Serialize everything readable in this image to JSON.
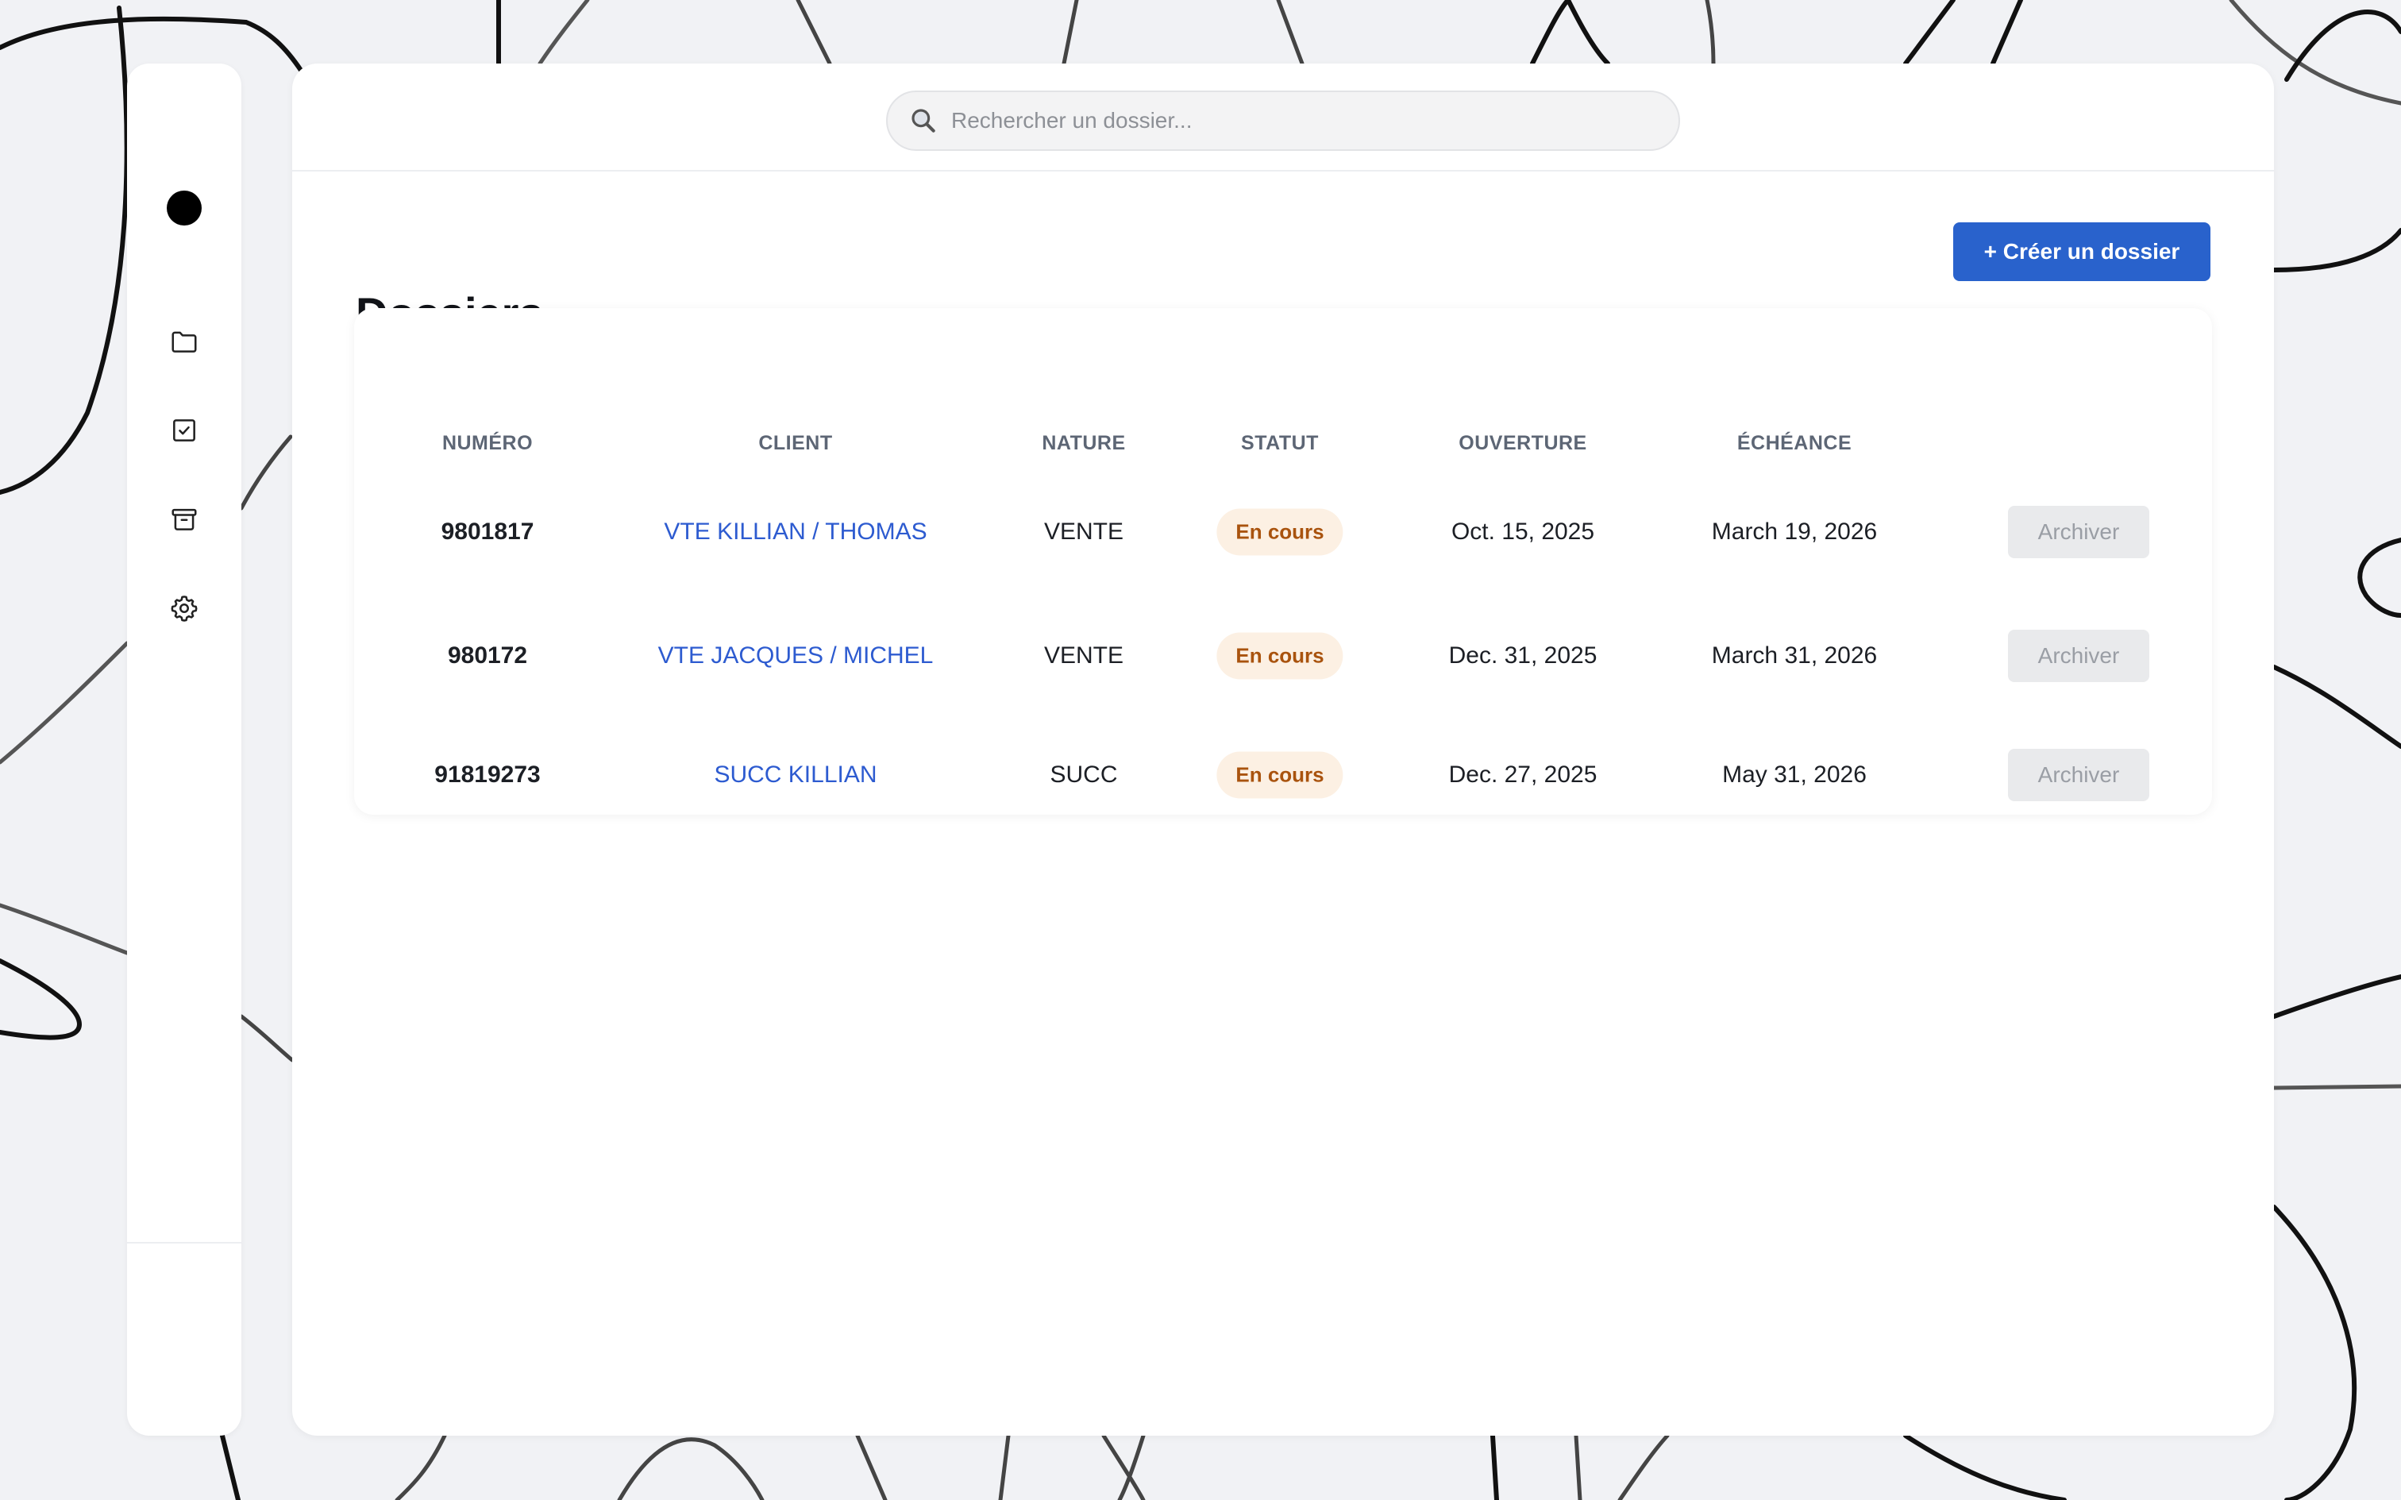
{
  "search": {
    "placeholder": "Rechercher un dossier..."
  },
  "header": {
    "title": "Dossiers",
    "create_label": "+ Créer un dossier"
  },
  "sidebar": {
    "items": [
      {
        "icon": "folder-icon"
      },
      {
        "icon": "checkbox-icon"
      },
      {
        "icon": "archive-icon"
      },
      {
        "icon": "gear-icon"
      }
    ]
  },
  "table": {
    "headers": {
      "numero": "NUMÉRO",
      "client": "CLIENT",
      "nature": "NATURE",
      "statut": "STATUT",
      "ouverture": "OUVERTURE",
      "echeance": "ÉCHÉANCE"
    },
    "rows": [
      {
        "numero": "9801817",
        "client": "VTE KILLIAN / THOMAS",
        "nature": "VENTE",
        "statut": "En cours",
        "ouverture": "Oct. 15, 2025",
        "echeance": "March 19, 2026",
        "action": "Archiver"
      },
      {
        "numero": "980172",
        "client": "VTE JACQUES / MICHEL",
        "nature": "VENTE",
        "statut": "En cours",
        "ouverture": "Dec. 31, 2025",
        "echeance": "March 31, 2026",
        "action": "Archiver"
      },
      {
        "numero": "91819273",
        "client": "SUCC KILLIAN",
        "nature": "SUCC",
        "statut": "En cours",
        "ouverture": "Dec. 27, 2025",
        "echeance": "May 31, 2026",
        "action": "Archiver"
      }
    ]
  },
  "colors": {
    "accent": "#2962cc",
    "link": "#2d5bd0",
    "badge_bg": "#fcf0e3",
    "badge_text": "#a9530e"
  }
}
